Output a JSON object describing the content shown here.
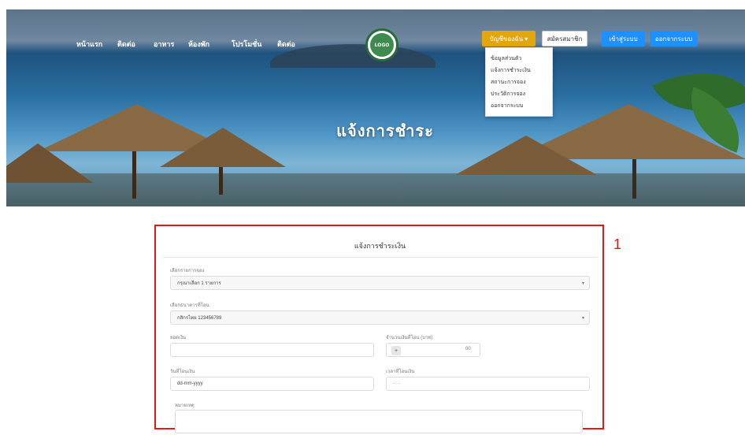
{
  "nav": {
    "items": [
      "หน้าแรก",
      "ติดต่อ",
      "อาหาร",
      "ห้องพัก",
      "โปรโมชั่น",
      "ติดต่อ"
    ]
  },
  "logo": {
    "text": "LOGO"
  },
  "header": {
    "member_button": "บัญชีของฉัน ▾",
    "register_button": "สมัครสมาชิก",
    "login_button": "เข้าสู่ระบบ",
    "logout_button": "ออกจากระบบ"
  },
  "dropdown": {
    "items": [
      "ข้อมูลส่วนตัว",
      "แจ้งการชำระเงิน",
      "สถานะการจอง",
      "ประวัติการจอง",
      "ออกจากระบบ"
    ]
  },
  "hero": {
    "title": "แจ้งการชำระ"
  },
  "annotation": {
    "number": "1"
  },
  "form": {
    "title": "แจ้งการชำระเงิน",
    "select_room_label": "เลือกรายการจอง",
    "select_room_value": "กรุณาเลือก 1 รายการ",
    "select_bank_label": "เลือกธนาคารที่โอน",
    "select_bank_value": "กสิกรไทย 123456789",
    "amount_label": "ยอดเงิน",
    "stepper_label": "จำนวนเงินที่โอน (บาท)",
    "stepper_minus": "+",
    "stepper_value": "00",
    "date_label": "วันที่โอนเงิน",
    "date_value": "dd-mm-yyyy",
    "time_label": "เวลาที่โอนเงิน",
    "time_placeholder": "--:--",
    "note_label": "หมายเหตุ"
  },
  "colors": {
    "accent_yellow": "#e2a70f",
    "accent_blue": "#1e90ff",
    "annotation_red": "#e01a1a"
  }
}
